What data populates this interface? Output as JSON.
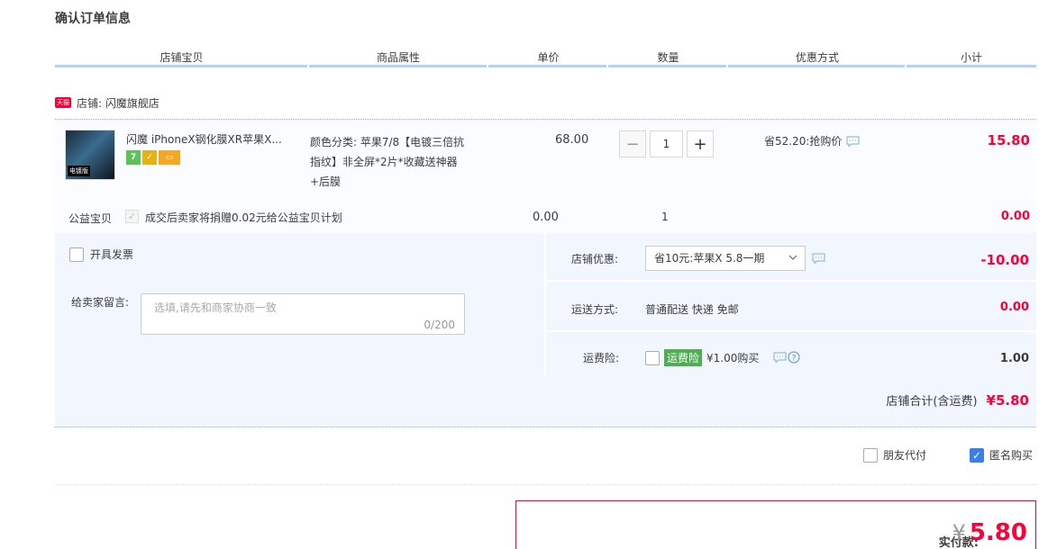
{
  "page_title": "确认订单信息",
  "columns": [
    "店铺宝贝",
    "商品属性",
    "单价",
    "数量",
    "优惠方式",
    "小计"
  ],
  "shop": {
    "badge": "天猫",
    "label": "店铺: 闪魔旗舰店"
  },
  "item": {
    "title": "闪魔 iPhoneX钢化膜XR苹果X...",
    "thumb_tag": "电镀版",
    "sku_lines": [
      "颜色分类: 苹果7/8【电镀三倍抗",
      "指纹】非全屏*2片*收藏送神器",
      "+后膜"
    ],
    "unit_price": "68.00",
    "quantity": "1",
    "qty_minus": "−",
    "qty_plus": "+",
    "promo": "省52.20:抢购价",
    "subtotal": "15.80"
  },
  "charity": {
    "label": "公益宝贝",
    "text": "成交后卖家将捐赠0.02元给公益宝贝计划",
    "price": "0.00",
    "qty": "1",
    "subtotal": "0.00"
  },
  "invoice": {
    "label": "开具发票",
    "checked": false
  },
  "message": {
    "label": "给卖家留言:",
    "placeholder": "选填,请先和商家协商一致",
    "counter": "0/200"
  },
  "shop_discount": {
    "label": "店铺优惠:",
    "selected": "省10元:苹果X 5.8一期",
    "amount": "-10.00"
  },
  "shipping": {
    "label": "运送方式:",
    "value": "普通配送 快递 免邮",
    "amount": "0.00"
  },
  "insurance": {
    "label": "运费险:",
    "badge": "运费险",
    "text": "¥1.00购买",
    "amount": "1.00",
    "checked": false
  },
  "shop_total": {
    "label": "店铺合计(含运费)",
    "amount": "¥5.80"
  },
  "options": {
    "friend_pay": {
      "label": "朋友代付",
      "checked": false
    },
    "anonymous": {
      "label": "匿名购买",
      "checked": true
    }
  },
  "payment": {
    "label": "实付款:",
    "currency": "¥",
    "amount": "5.80"
  },
  "colors": {
    "accent_red": "#ff0036",
    "header_line": "#b2d1ff",
    "panel_bg": "#f2f7ff",
    "check_blue": "#3b7de9"
  }
}
